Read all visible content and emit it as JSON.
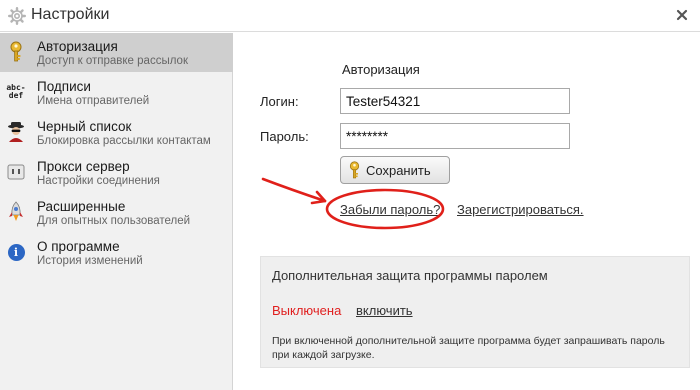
{
  "window": {
    "title": "Настройки",
    "icons": {
      "title": "gear-icon",
      "close": "close-icon"
    }
  },
  "sidebar": {
    "items": [
      {
        "label": "Авторизация",
        "sub": "Доступ к отправке рассылок",
        "icon": "key-icon",
        "active": true
      },
      {
        "label": "Подписи",
        "sub": "Имена отправителей",
        "icon": "abc-def-icon",
        "icon_text": [
          "abc-",
          "def"
        ],
        "active": false
      },
      {
        "label": "Черный список",
        "sub": "Блокировка рассылки контактам",
        "icon": "spy-icon",
        "active": false
      },
      {
        "label": "Прокси сервер",
        "sub": "Настройки соединения",
        "icon": "socket-icon",
        "active": false
      },
      {
        "label": "Расширенные",
        "sub": "Для опытных пользователей",
        "icon": "rocket-icon",
        "active": false
      },
      {
        "label": "О программе",
        "sub": "История изменений",
        "icon": "info-icon",
        "icon_text": "i",
        "active": false
      }
    ]
  },
  "auth": {
    "heading": "Авторизация",
    "login_label": "Логин:",
    "login_value": "Tester54321",
    "password_label": "Пароль:",
    "password_value": "********",
    "save_label": "Сохранить",
    "forgot_link": "Забыли пароль?",
    "register_link": "Зарегистрироваться."
  },
  "protection": {
    "title": "Дополнительная защита программы паролем",
    "status": "Выключена",
    "enable_link": "включить",
    "note": "При включенной дополнительной защите программа будет запрашивать пароль при каждой загрузке."
  },
  "annotation": {
    "color": "#e0201a"
  },
  "colors": {
    "active_item": "#cfcfcf",
    "sidebar_bg": "#f1f1f1",
    "status_off": "#e02020"
  }
}
